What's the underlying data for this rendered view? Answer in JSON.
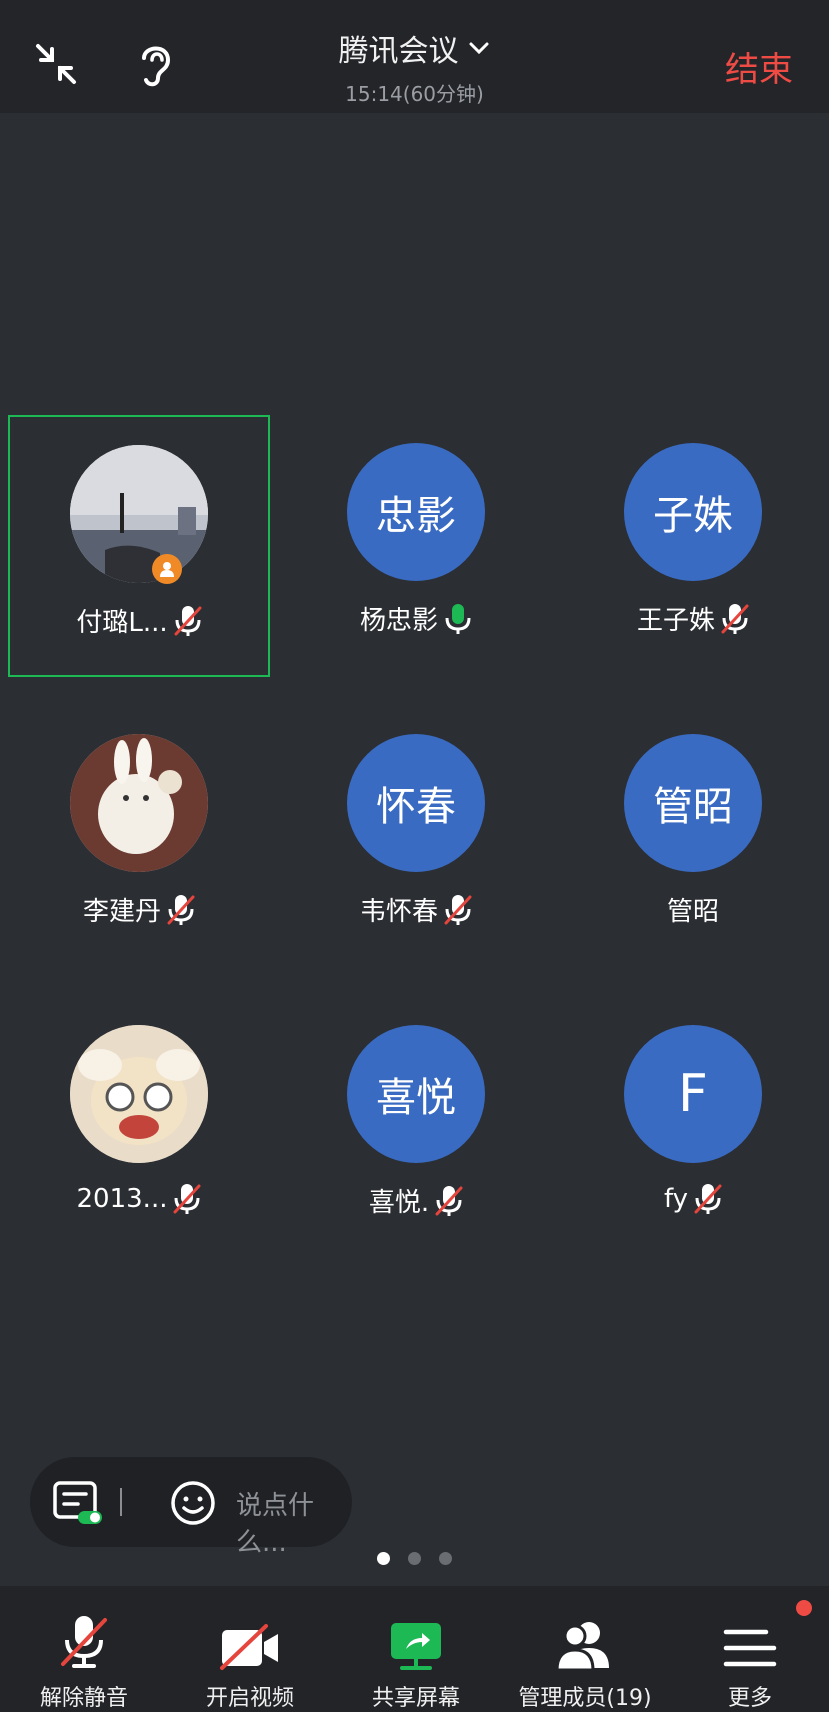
{
  "header": {
    "title": "腾讯会议",
    "subtitle": "15:14(60分钟)",
    "end_label": "结束"
  },
  "participants": [
    {
      "name": "付璐L...",
      "avatar_text": "",
      "mic": "muted",
      "active": true,
      "host": true
    },
    {
      "name": "杨忠影",
      "avatar_text": "忠影",
      "mic": "on"
    },
    {
      "name": "王子姝",
      "avatar_text": "子姝",
      "mic": "muted"
    },
    {
      "name": "李建丹",
      "avatar_text": "",
      "mic": "muted"
    },
    {
      "name": "韦怀春",
      "avatar_text": "怀春",
      "mic": "muted"
    },
    {
      "name": "管昭",
      "avatar_text": "管昭",
      "mic": "none"
    },
    {
      "name": "2013...",
      "avatar_text": "",
      "mic": "muted"
    },
    {
      "name": "喜悦.",
      "avatar_text": "喜悦",
      "mic": "muted"
    },
    {
      "name": "fy",
      "avatar_text": "F",
      "mic": "muted"
    }
  ],
  "chat": {
    "placeholder": "说点什么..."
  },
  "pager": {
    "pages": 3,
    "current": 1
  },
  "toolbar": {
    "unmute": "解除静音",
    "video": "开启视频",
    "share": "共享屏幕",
    "members": "管理成员(19)",
    "more": "更多"
  },
  "colors": {
    "end": "#ef4b45",
    "avatar": "#3a6bc2",
    "active_border": "#1db954",
    "share": "#1db954"
  }
}
